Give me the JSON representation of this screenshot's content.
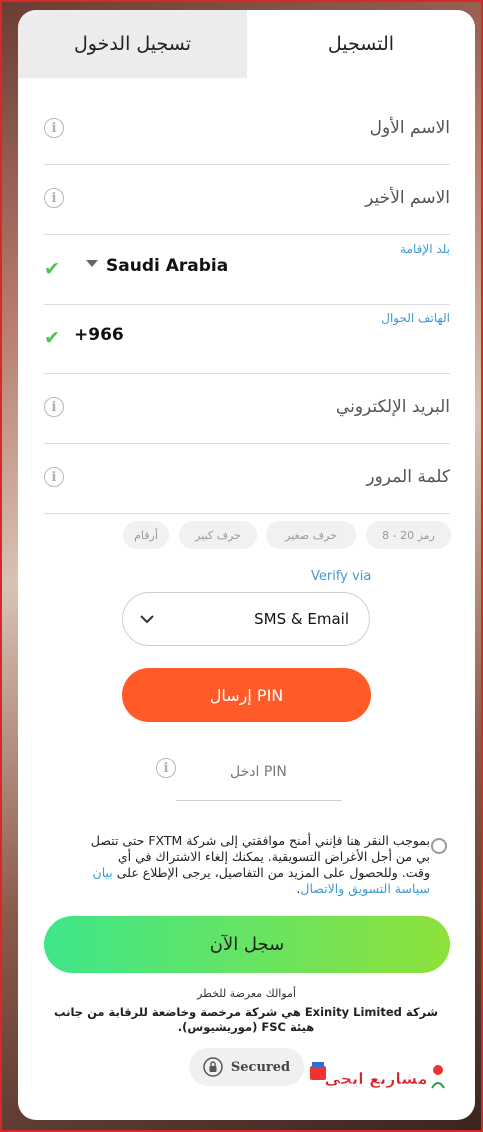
{
  "tabs": {
    "login": "تسجيل الدخول",
    "register": "التسجيل"
  },
  "form": {
    "first_name": "الاسم الأول",
    "last_name": "الاسم الأخير",
    "country_label": "بلد الإقامة",
    "country_value": "Saudi Arabia",
    "phone_label": "الهاتف الجوال",
    "phone_value": "+966",
    "email": "البريد الإلكتروني",
    "password": "كلمة المرور"
  },
  "password_rules": [
    "8 - 20 رمز",
    "حرف صغير",
    "حرف كبير",
    "أرقام"
  ],
  "verify": {
    "label": "Verify via",
    "selected": "SMS & Email"
  },
  "pin": {
    "send_label": "إرسال PIN",
    "input_placeholder": "ادخل PIN"
  },
  "consent": {
    "text": "بموجب النقر هنا فإنني أمنح موافقتي إلى شركة FXTM حتى تتصل بي من أجل الأغراض التسويقية. يمكنك إلغاء الاشتراك في أي وقت. وللحصول على المزيد من التفاصيل، يرجى الإطلاع على",
    "link": "بيان سياسة التسويق والاتصال",
    "end": "."
  },
  "submit_label": "سجل الآن",
  "risk_text": "أموالك معرضة للخطر",
  "legal_text": "شركة Exinity Limited هي شركة مرخصة وخاضعة للرقابة من جانب هيئة FSC (موريشيوس).",
  "secured_label": "Secured",
  "logo_text": "مشاريع ايجي",
  "colors": {
    "accent_orange": "#ff5a27",
    "link_blue": "#3e9ad6",
    "check_green": "#4cc552"
  }
}
